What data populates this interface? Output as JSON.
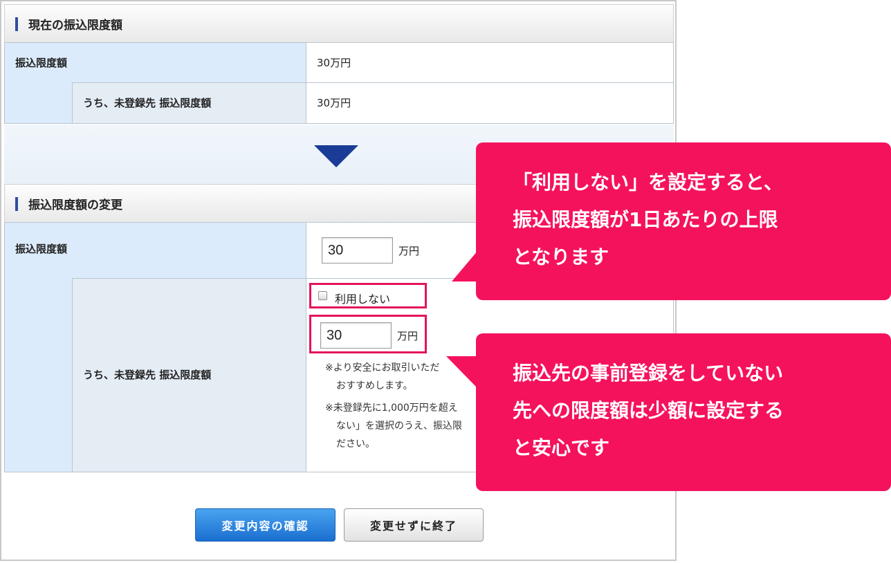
{
  "current_section": {
    "title": "現在の振込限度額",
    "rows": [
      {
        "label": "振込限度額",
        "value": "30万円"
      },
      {
        "label": "うち、未登録先 振込限度額",
        "value": "30万円"
      }
    ]
  },
  "change_section": {
    "title": "振込限度額の変更",
    "limit_label": "振込限度額",
    "limit_value": "30",
    "limit_unit": "万円",
    "unreg_label": "うち、未登録先 振込限度額",
    "checkbox_label": "利用しない",
    "checkbox_checked": false,
    "unreg_value": "30",
    "unreg_unit": "万円",
    "notes": [
      [
        "※より安全にお取引いただ",
        "おすすめします。"
      ],
      [
        "※未登録先に1,000万円を超え",
        "ない」を選択のうえ、振込限",
        "ださい。"
      ]
    ]
  },
  "buttons": {
    "confirm": "変更内容の確認",
    "cancel": "変更せずに終了"
  },
  "callouts": [
    {
      "lines": [
        "「利用しない」を設定すると、",
        "振込限度額が1日あたりの上限",
        "となります"
      ]
    },
    {
      "lines": [
        "振込先の事前登録をしていない",
        "先への限度額は少額に設定する",
        "と安心です"
      ]
    }
  ],
  "colors": {
    "callout": "#f5125d",
    "highlight": "#e4125d",
    "arrow": "#1a3c97",
    "primary_button": "#1a6fd0"
  }
}
